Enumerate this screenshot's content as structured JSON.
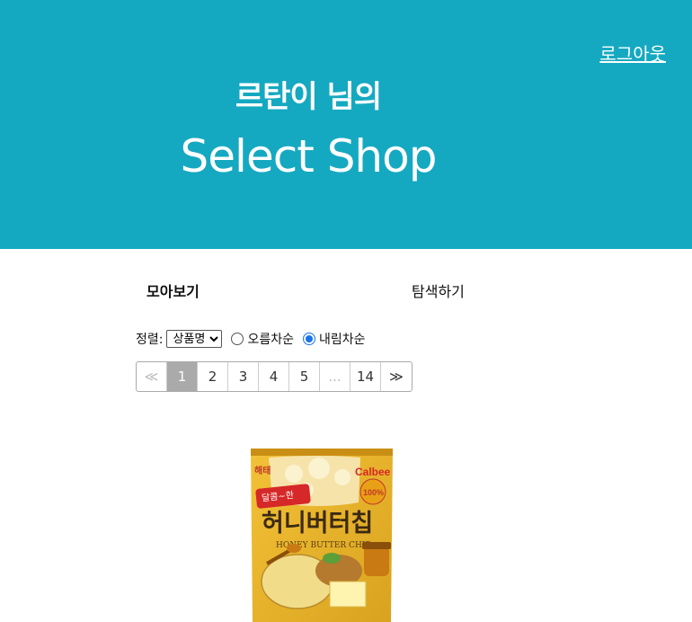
{
  "header": {
    "logout_label": "로그아웃",
    "greeting": "르탄이 님의",
    "brand": "Select Shop",
    "bg_color": "#15a9c1"
  },
  "tabs": {
    "all": "모아보기",
    "search": "탐색하기"
  },
  "sort": {
    "label": "정렬:",
    "selected_option": "상품명",
    "asc_label": "오름차순",
    "desc_label": "내림차순",
    "selected_order": "desc"
  },
  "pagination": {
    "prev": "≪",
    "pages": [
      "1",
      "2",
      "3",
      "4",
      "5"
    ],
    "ellipsis": "...",
    "last": "14",
    "next": "≫",
    "current": "1"
  },
  "product": {
    "brand_text": "해태",
    "calbee_text": "Calbee",
    "title_text": "허니버터칩",
    "subtitle_text": "HONEY BUTTER CHIP",
    "badge_text": "100%",
    "ribbon_text": "달콤~한"
  }
}
